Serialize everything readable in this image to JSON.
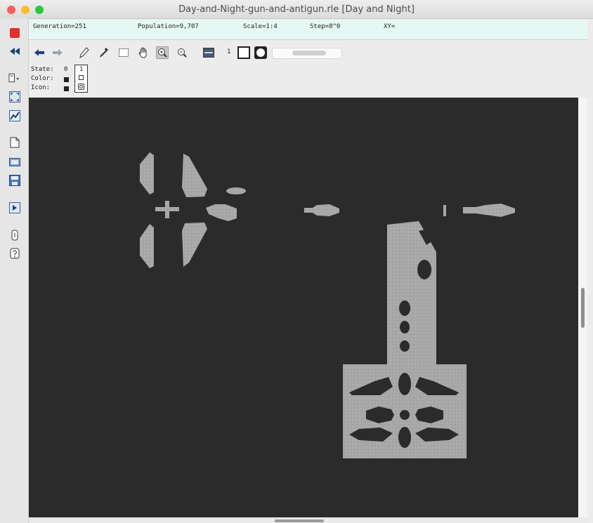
{
  "window": {
    "title": "Day-and-Night-gun-and-antigun.rle [Day and Night]"
  },
  "status": {
    "generation": "Generation=251",
    "population": "Population=9,707",
    "scale": "Scale=1:4",
    "step": "Step=8^0",
    "xy": "XY="
  },
  "toolbar": {
    "state_number": "1",
    "scale_slider_value": 0.55
  },
  "state_panel": {
    "state_label": "State:",
    "state_value": "0",
    "color_label": "Color:",
    "icon_label": "Icon:",
    "selected_state": "1"
  },
  "colors": {
    "live": "#b6b6b6",
    "dead": "#2b2b2b",
    "stop_button": "#e0312c",
    "status_bg": "#e6f8f3",
    "toolbar_icon": "#1f3f78"
  },
  "icons": {
    "left": [
      "stop-icon",
      "reset-icon",
      "algorithm-icon",
      "fit-icon",
      "chart-icon",
      "new-pattern-icon",
      "open-pattern-icon",
      "save-pattern-icon",
      "open-script-icon",
      "info-icon",
      "help-icon"
    ],
    "top": [
      "undo-icon",
      "redo-icon",
      "draw-icon",
      "pick-icon",
      "select-icon",
      "move-icon",
      "zoom-in-icon",
      "zoom-out-icon",
      "layers-icon"
    ]
  }
}
